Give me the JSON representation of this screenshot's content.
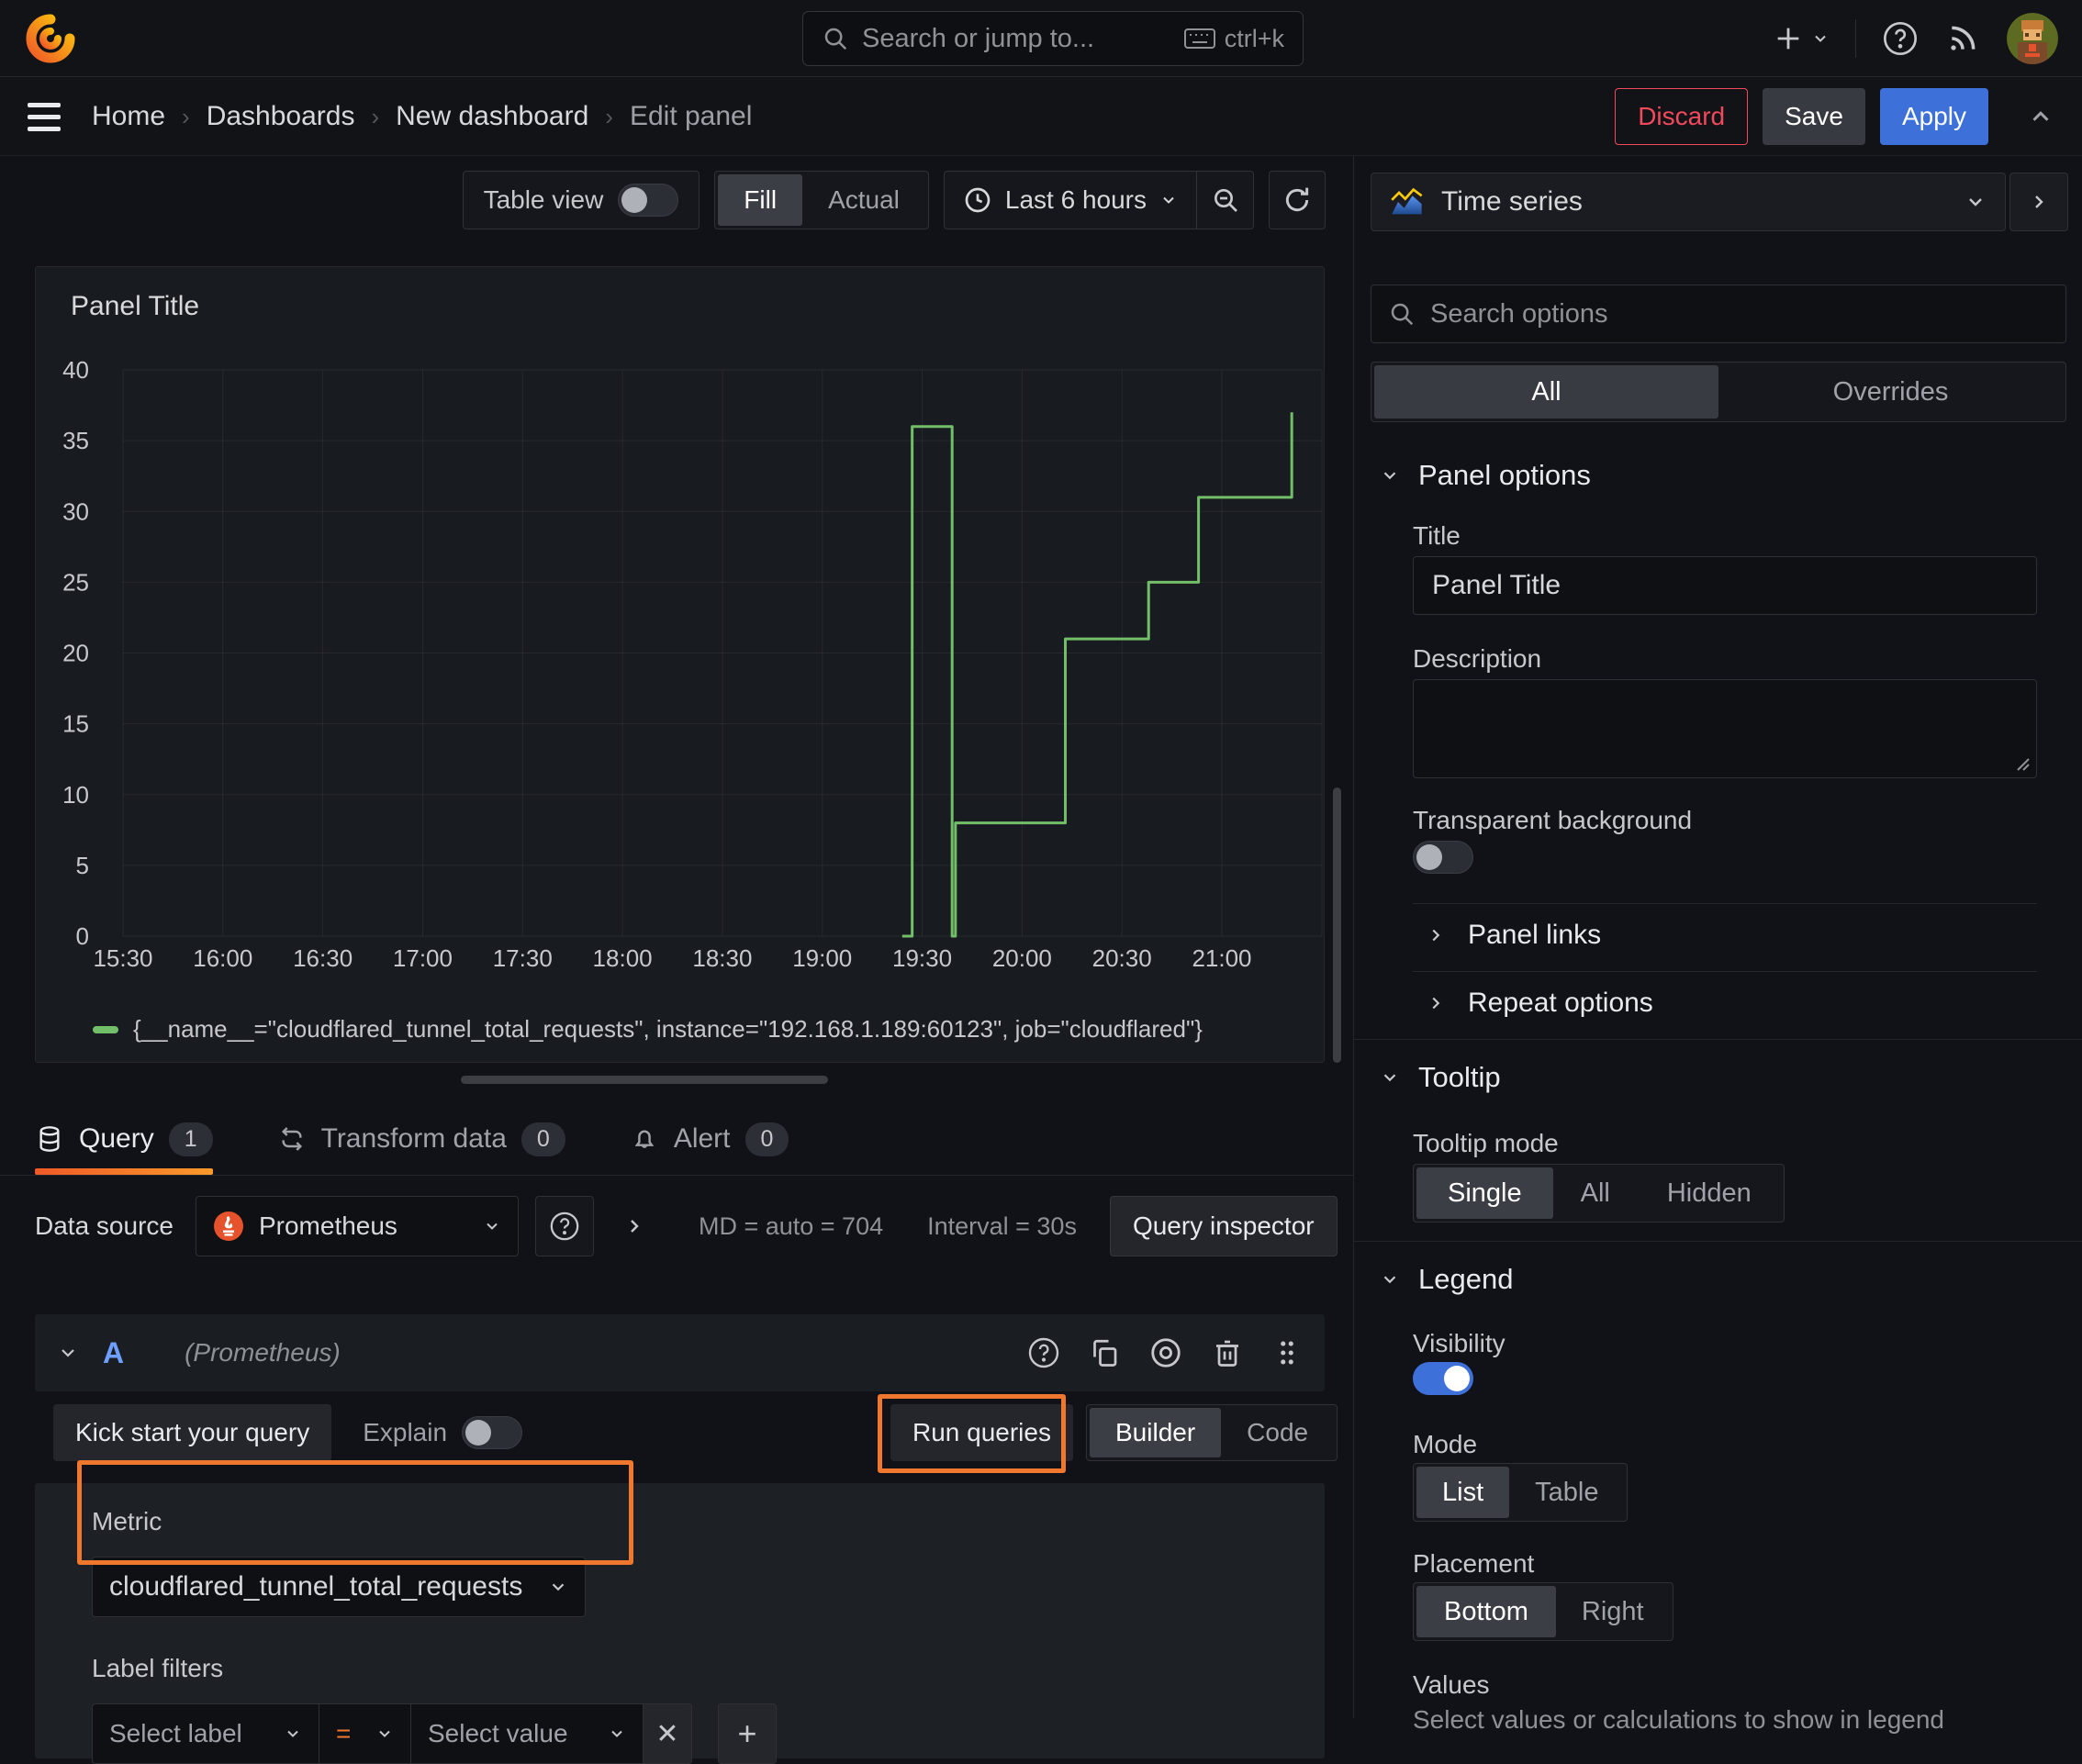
{
  "topbar": {
    "search_placeholder": "Search or jump to...",
    "shortcut": "ctrl+k"
  },
  "breadcrumb": {
    "items": [
      "Home",
      "Dashboards",
      "New dashboard",
      "Edit panel"
    ]
  },
  "header_actions": {
    "discard": "Discard",
    "save": "Save",
    "apply": "Apply"
  },
  "toolbar": {
    "table_view": "Table view",
    "fill": "Fill",
    "actual": "Actual",
    "time_range": "Last 6 hours"
  },
  "panel": {
    "title": "Panel Title"
  },
  "chart_data": {
    "type": "line",
    "line_style": "step-after",
    "title": "Panel Title",
    "x_ticks": [
      "15:30",
      "16:00",
      "16:30",
      "17:00",
      "17:30",
      "18:00",
      "18:30",
      "19:00",
      "19:30",
      "20:00",
      "20:30",
      "21:00"
    ],
    "y_ticks": [
      0,
      5,
      10,
      15,
      20,
      25,
      30,
      35,
      40
    ],
    "ylim": [
      0,
      40
    ],
    "x_range": [
      "15:30",
      "21:00"
    ],
    "grid": true,
    "legend_position": "bottom",
    "series": [
      {
        "name": "{__name__=\"cloudflared_tunnel_total_requests\", instance=\"192.168.1.189:60123\", job=\"cloudflared\"}",
        "color": "#73bf69",
        "points": [
          [
            "19:24",
            0
          ],
          [
            "19:27",
            36
          ],
          [
            "19:39",
            0
          ],
          [
            "19:40",
            8
          ],
          [
            "20:13",
            21
          ],
          [
            "20:38",
            25
          ],
          [
            "20:53",
            31
          ],
          [
            "21:21",
            37
          ]
        ]
      }
    ]
  },
  "tabs": {
    "query": "Query",
    "query_count": "1",
    "transform": "Transform data",
    "transform_count": "0",
    "alert": "Alert",
    "alert_count": "0"
  },
  "datasource": {
    "label": "Data source",
    "name": "Prometheus",
    "md_text": "MD = auto = 704",
    "interval_text": "Interval = 30s",
    "inspector": "Query inspector"
  },
  "query_editor": {
    "ref_id": "A",
    "ds_hint": "(Prometheus)",
    "kick_start": "Kick start your query",
    "explain": "Explain",
    "run_queries": "Run queries",
    "builder": "Builder",
    "code": "Code",
    "metric_label": "Metric",
    "metric_value": "cloudflared_tunnel_total_requests",
    "filters_label": "Label filters",
    "select_label": "Select label",
    "operator": "=",
    "select_value": "Select value"
  },
  "options_panel": {
    "visualization": "Time series",
    "search_placeholder": "Search options",
    "tab_all": "All",
    "tab_overrides": "Overrides",
    "panel_options": {
      "header": "Panel options",
      "title_label": "Title",
      "title_value": "Panel Title",
      "description_label": "Description",
      "transparent_label": "Transparent background",
      "links": "Panel links",
      "repeat": "Repeat options"
    },
    "tooltip": {
      "header": "Tooltip",
      "mode_label": "Tooltip mode",
      "options": [
        "Single",
        "All",
        "Hidden"
      ],
      "selected": "Single"
    },
    "legend": {
      "header": "Legend",
      "visibility_label": "Visibility",
      "mode_label": "Mode",
      "modes": [
        "List",
        "Table"
      ],
      "selected_mode": "List",
      "placement_label": "Placement",
      "placements": [
        "Bottom",
        "Right"
      ],
      "selected_placement": "Bottom",
      "values_label": "Values",
      "values_help": "Select values or calculations to show in legend"
    }
  },
  "colors": {
    "annotation_orange": "#f0772e",
    "series_green": "#73bf69",
    "apply_blue": "#3d71d9",
    "discard_red": "#f2495c",
    "tab_underline": [
      "#f05a28",
      "#fb9a2a"
    ]
  }
}
